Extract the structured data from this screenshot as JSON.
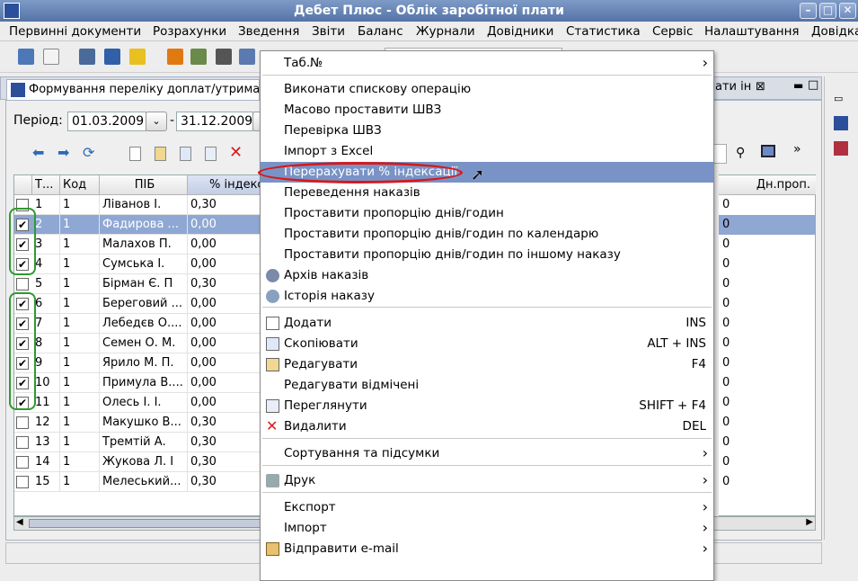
{
  "window": {
    "title": "Дебет Плюс - Облік заробітної плати"
  },
  "menubar": [
    "Первинні документи",
    "Розрахунки",
    "Зведення",
    "Звіти",
    "Баланс",
    "Журнали",
    "Довідники",
    "Статистика",
    "Сервіс",
    "Налаштування",
    "Довідка"
  ],
  "tab": {
    "label": "Формування переліку доплат/утримань"
  },
  "tab_right": {
    "label": "ати ін"
  },
  "period": {
    "label": "Період:",
    "from": "01.03.2009",
    "sep": "-",
    "to": "31.12.2009"
  },
  "grid": {
    "headers": [
      "Т...",
      "Код",
      "ПІБ",
      "% індекс"
    ],
    "right_header": "Дн.проп.",
    "rows": [
      {
        "tab": "1",
        "code": "1",
        "name": "Ліванов І.",
        "pct": "0,30",
        "checked": false,
        "dn": "0"
      },
      {
        "tab": "2",
        "code": "1",
        "name": "Фадирова ...",
        "pct": "0,00",
        "checked": true,
        "dn": "0"
      },
      {
        "tab": "3",
        "code": "1",
        "name": "Малахов П.",
        "pct": "0,00",
        "checked": true,
        "dn": "0"
      },
      {
        "tab": "4",
        "code": "1",
        "name": "Сумська І.",
        "pct": "0,00",
        "checked": true,
        "dn": "0"
      },
      {
        "tab": "5",
        "code": "1",
        "name": "Бірман Є. П",
        "pct": "0,30",
        "checked": false,
        "dn": "0"
      },
      {
        "tab": "6",
        "code": "1",
        "name": "Береговий ...",
        "pct": "0,00",
        "checked": true,
        "dn": "0"
      },
      {
        "tab": "7",
        "code": "1",
        "name": "Лебедєв О....",
        "pct": "0,00",
        "checked": true,
        "dn": "0"
      },
      {
        "tab": "8",
        "code": "1",
        "name": "Семен О. М.",
        "pct": "0,00",
        "checked": true,
        "dn": "0"
      },
      {
        "tab": "9",
        "code": "1",
        "name": "Ярило М. П.",
        "pct": "0,00",
        "checked": true,
        "dn": "0"
      },
      {
        "tab": "10",
        "code": "1",
        "name": "Примула В....",
        "pct": "0,00",
        "checked": true,
        "dn": "0"
      },
      {
        "tab": "11",
        "code": "1",
        "name": "Олесь І. І.",
        "pct": "0,00",
        "checked": true,
        "dn": "0"
      },
      {
        "tab": "12",
        "code": "1",
        "name": "Макушко В...",
        "pct": "0,30",
        "checked": false,
        "dn": "0"
      },
      {
        "tab": "13",
        "code": "1",
        "name": "Тремтій А.",
        "pct": "0,30",
        "checked": false,
        "dn": "0"
      },
      {
        "tab": "14",
        "code": "1",
        "name": "Жукова Л. І",
        "pct": "0,30",
        "checked": false,
        "dn": "0"
      },
      {
        "tab": "15",
        "code": "1",
        "name": "Мелеський...",
        "pct": "0,30",
        "checked": false,
        "dn": "0"
      }
    ]
  },
  "context_menu": {
    "items": [
      {
        "label": "Таб.№",
        "submenu": true
      },
      {
        "label": "Виконати спискову операцію"
      },
      {
        "label": "Масово проставити ШВЗ"
      },
      {
        "label": "Перевірка ШВЗ"
      },
      {
        "label": "Імпорт з Excel"
      },
      {
        "label": "Перерахувати % індексації",
        "highlighted": true
      },
      {
        "label": "Переведення наказів"
      },
      {
        "label": "Проставити пропорцію днів/годин"
      },
      {
        "label": "Проставити пропорцію днів/годин по календарю"
      },
      {
        "label": "Проставити пропорцію днів/годин по іншому наказу"
      },
      {
        "label": "Архів наказів",
        "icon": "archive-icon"
      },
      {
        "label": "Історія наказу",
        "icon": "history-icon"
      },
      {
        "label": "Додати",
        "shortcut": "INS",
        "icon": "document-icon"
      },
      {
        "label": "Скопіювати",
        "shortcut": "ALT + INS",
        "icon": "copy-icon"
      },
      {
        "label": "Редагувати",
        "shortcut": "F4",
        "icon": "edit-icon"
      },
      {
        "label": "Редагувати відмічені"
      },
      {
        "label": "Переглянути",
        "shortcut": "SHIFT + F4",
        "icon": "view-icon"
      },
      {
        "label": "Видалити",
        "shortcut": "DEL",
        "icon": "delete-icon"
      },
      {
        "label": "Сортування та підсумки",
        "submenu": true
      },
      {
        "label": "Друк",
        "submenu": true,
        "icon": "printer-icon"
      },
      {
        "label": "Експорт",
        "submenu": true
      },
      {
        "label": "Імпорт",
        "submenu": true
      },
      {
        "label": "Відправити e-mail",
        "submenu": true,
        "icon": "email-icon"
      }
    ]
  },
  "colors": {
    "accent": "#7993c6",
    "selection": "#8fa7d3",
    "annotation_red": "#d7191c",
    "annotation_green": "#2f9a2f"
  }
}
